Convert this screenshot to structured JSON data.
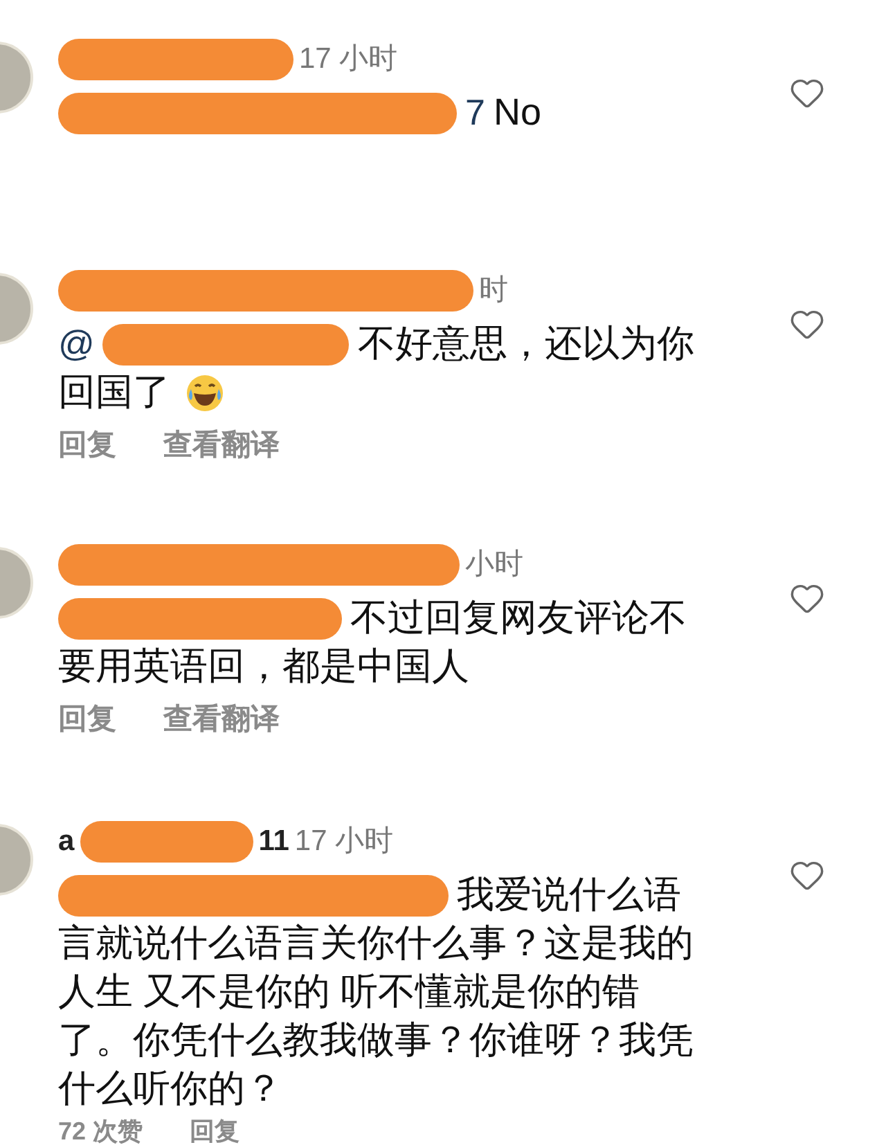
{
  "comments": [
    {
      "header": [
        {
          "kind": "redaction"
        },
        {
          "kind": "time",
          "text": "17 小时"
        }
      ],
      "prefix": [
        {
          "kind": "redaction"
        },
        {
          "kind": "mention",
          "text": "7"
        }
      ],
      "body_lines": [
        "No"
      ],
      "emoji": false
    },
    {
      "header": [
        {
          "kind": "redaction"
        },
        {
          "kind": "time",
          "text": "时"
        }
      ],
      "prefix": [
        {
          "kind": "mention",
          "text": "@"
        },
        {
          "kind": "redaction"
        }
      ],
      "body_lines": [
        "不好意思，还以为你",
        "回国了"
      ],
      "emoji": true,
      "actions": [
        "回复",
        "查看翻译"
      ]
    },
    {
      "header": [
        {
          "kind": "redaction"
        },
        {
          "kind": "time",
          "text": "小时"
        }
      ],
      "prefix": [
        {
          "kind": "redaction"
        }
      ],
      "body_lines": [
        "不过回复网友评论不",
        "要用英语回，都是中国人"
      ],
      "emoji": false,
      "actions": [
        "回复",
        "查看翻译"
      ]
    },
    {
      "header": [
        {
          "kind": "user",
          "text": "a"
        },
        {
          "kind": "redaction"
        },
        {
          "kind": "user",
          "text": "11"
        },
        {
          "kind": "time",
          "text": "17 小时"
        }
      ],
      "prefix": [
        {
          "kind": "redaction"
        }
      ],
      "body_lines": [
        "我爱说什么语",
        "言就说什么语言关你什么事？这是我的",
        "人生 又不是你的 听不懂就是你的错",
        "了。你凭什么教我做事？你谁呀？我凭",
        "什么听你的？"
      ],
      "emoji": false,
      "actions": [
        "72 次赞",
        "回复"
      ]
    }
  ]
}
